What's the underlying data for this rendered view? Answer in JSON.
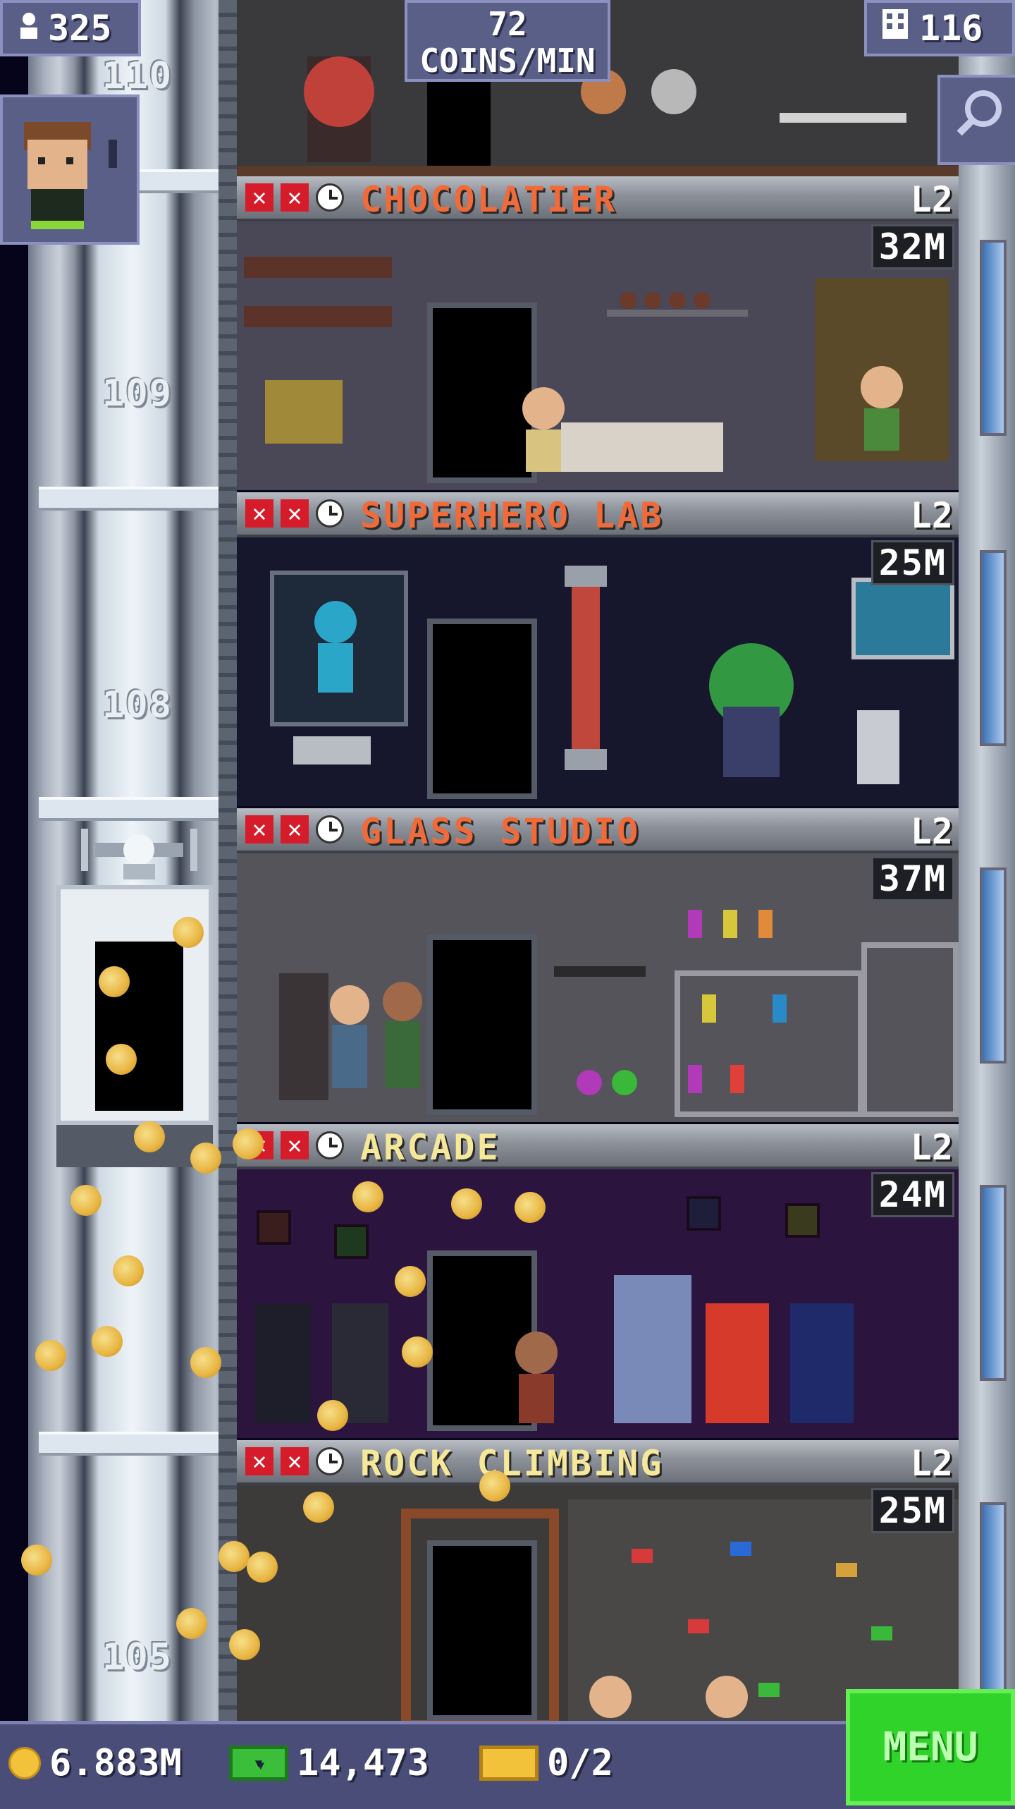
{
  "hud": {
    "population": "325",
    "coins_per_min_value": "72",
    "coins_per_min_label": "COINS/MIN",
    "floors_total": "116"
  },
  "shaft_floor_numbers": [
    "110",
    "109",
    "108",
    "105"
  ],
  "floors": [
    {
      "name": "CHOCOLATIER",
      "level": "L2",
      "value": "32M",
      "name_color": "#f06a3a",
      "wall": "#4a4756"
    },
    {
      "name": "SUPERHERO LAB",
      "level": "L2",
      "value": "25M",
      "name_color": "#f06a3a",
      "wall": "#16162c"
    },
    {
      "name": "GLASS STUDIO",
      "level": "L2",
      "value": "37M",
      "name_color": "#f06a3a",
      "wall": "#55545a"
    },
    {
      "name": "ARCADE",
      "level": "L2",
      "value": "24M",
      "name_color": "#f5e89a",
      "wall": "#2b143e"
    },
    {
      "name": "ROCK CLIMBING",
      "level": "L2",
      "value": "25M",
      "name_color": "#f5e89a",
      "wall": "#3d3b3a"
    }
  ],
  "bottom_bar": {
    "coins": "6.883M",
    "bux": "14,473",
    "tickets": "0/2",
    "menu_label": "MENU"
  },
  "icons": {
    "population": "person-icon",
    "floors": "building-icon",
    "zoom": "magnifier-icon",
    "coins": "coin-icon",
    "bux": "bux-icon",
    "tickets": "ticket-icon"
  }
}
